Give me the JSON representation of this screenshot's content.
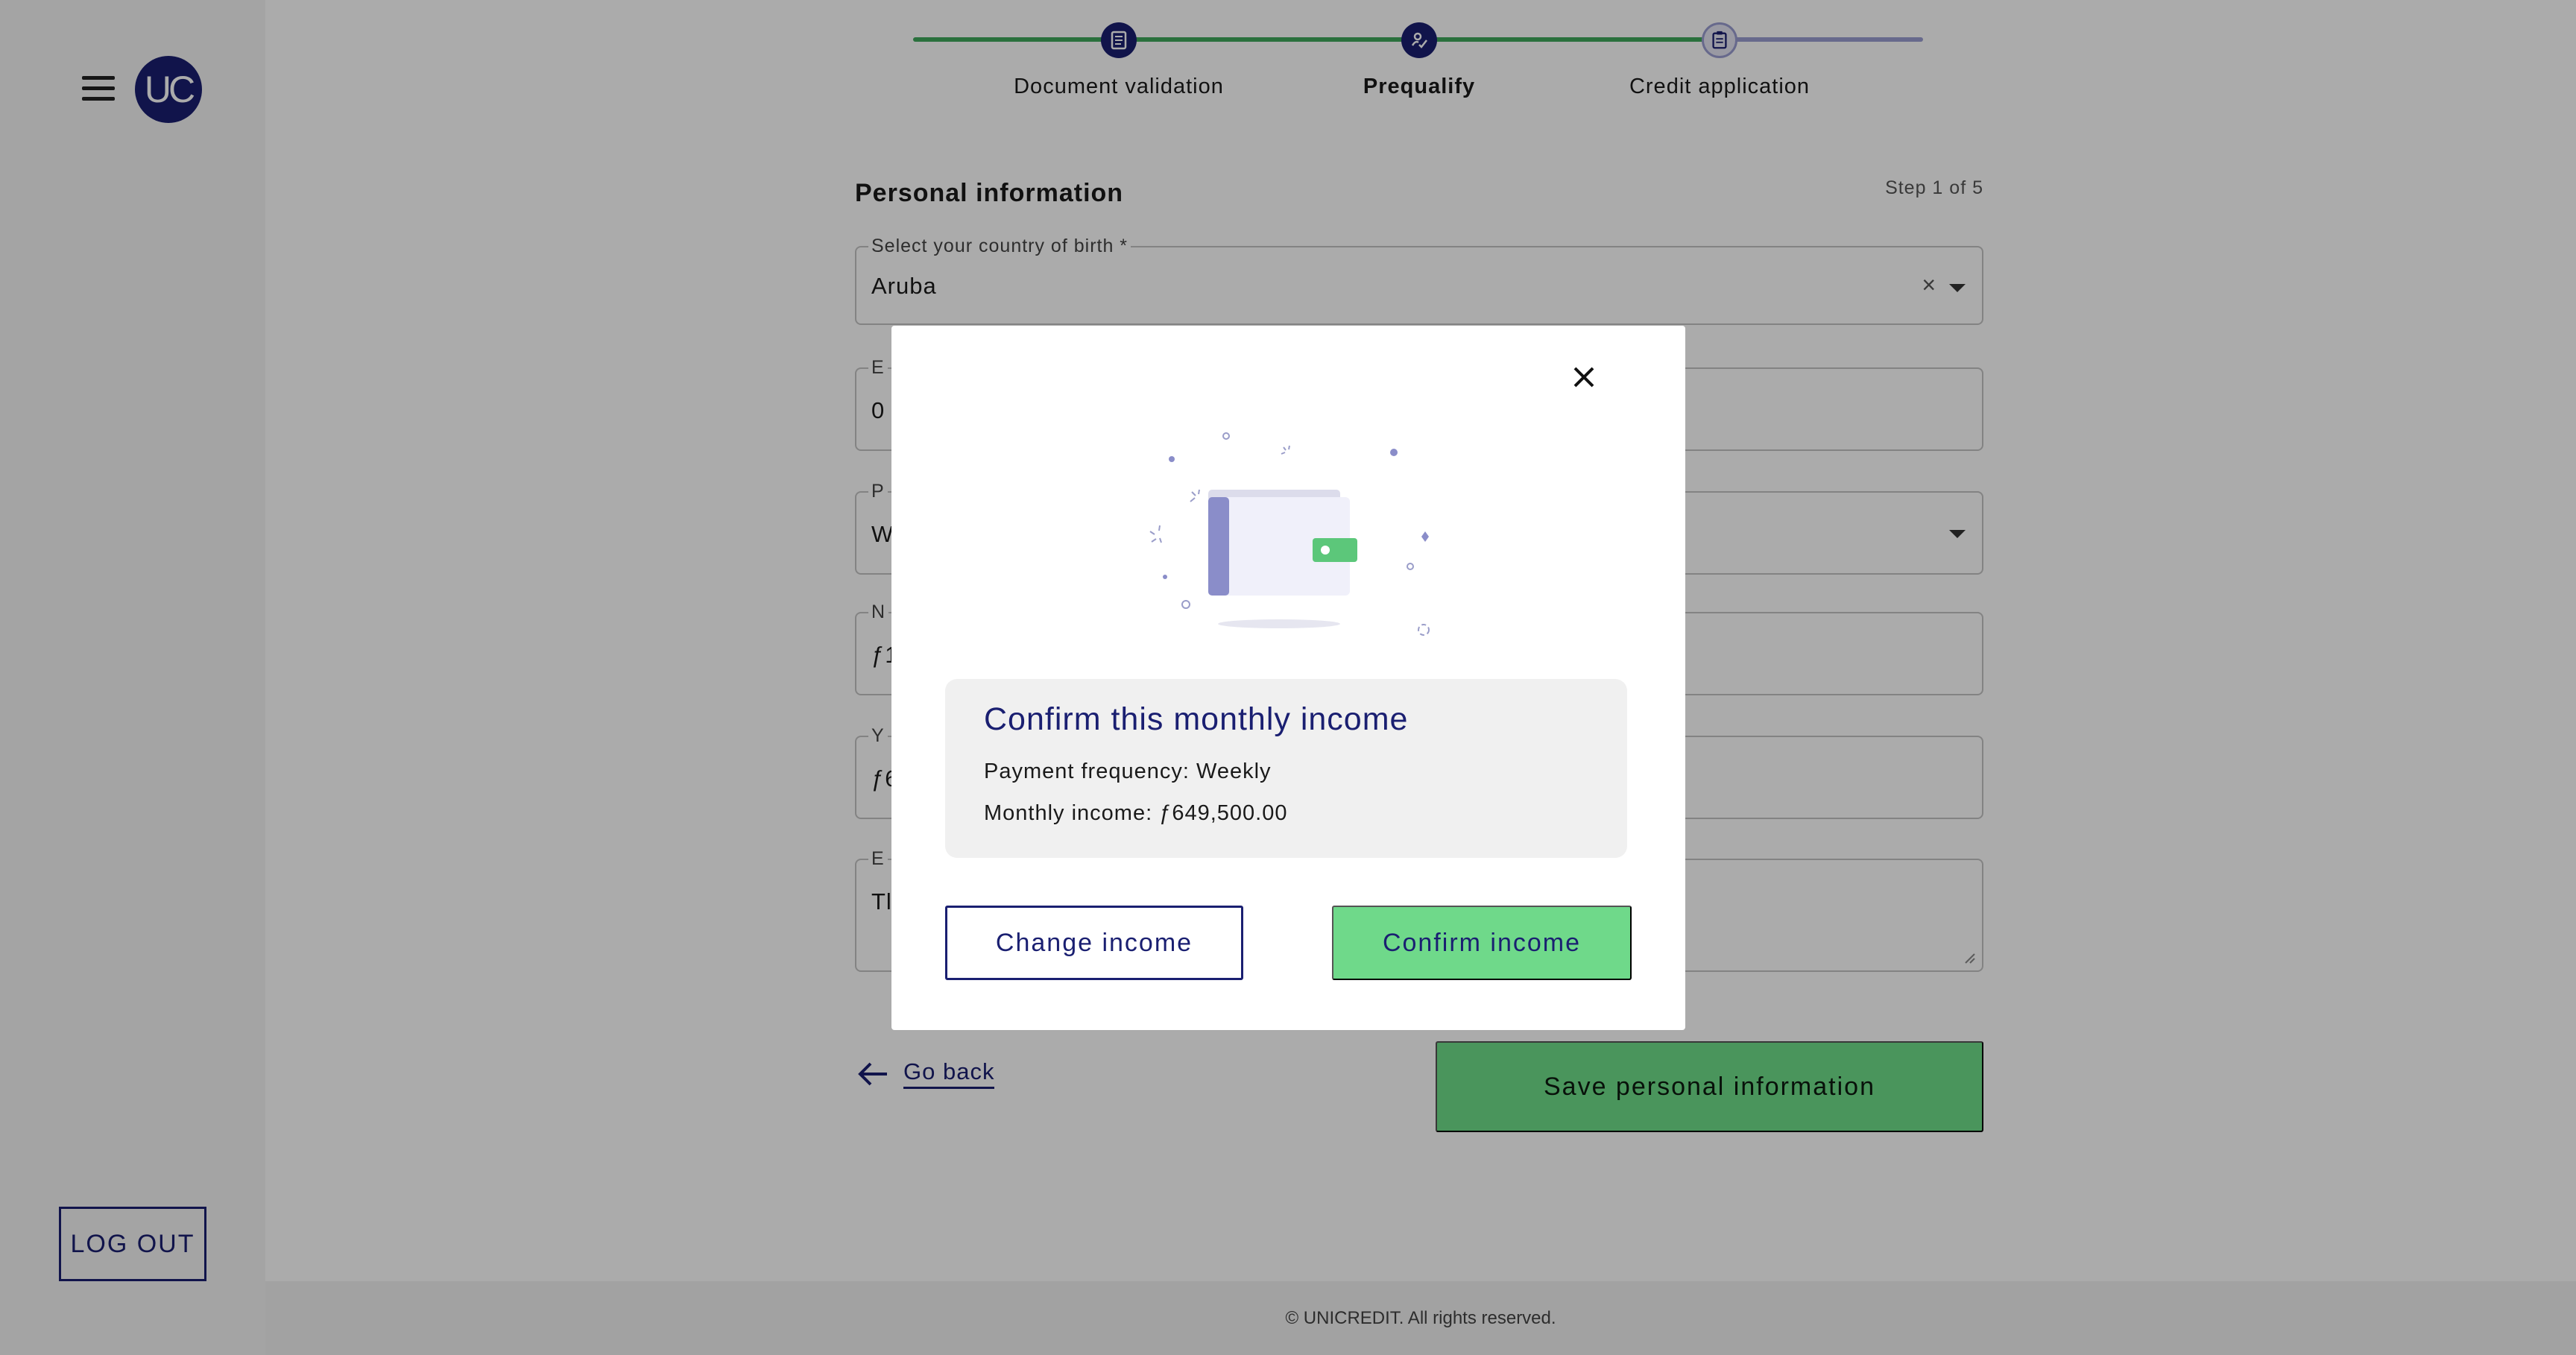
{
  "sidebar": {
    "menu_icon": "hamburger-menu-icon",
    "avatar_initials": "UC",
    "logout_label": "LOG OUT"
  },
  "stepper": {
    "steps": [
      {
        "label": "Document validation",
        "icon": "document-icon",
        "state": "complete"
      },
      {
        "label": "Prequalify",
        "icon": "signature-check-icon",
        "state": "current"
      },
      {
        "label": "Credit application",
        "icon": "clipboard-icon",
        "state": "upcoming"
      }
    ]
  },
  "form": {
    "title": "Personal information",
    "step_count": "Step 1 of 5",
    "country_label": "Select your country of birth *",
    "country_value": "Aruba",
    "field2_label": "E",
    "field2_value": "0",
    "field3_label": "P",
    "field3_value": "W",
    "field4_label": "N",
    "field4_value": "ƒ1",
    "field5_label": "Y",
    "field5_value": "ƒ6",
    "field6_label": "E",
    "field6_value": "Tl",
    "go_back_label": "Go back",
    "save_label": "Save personal information"
  },
  "modal": {
    "illustration_icon": "wallet-illustration-icon",
    "title": "Confirm this monthly income",
    "payment_frequency": "Payment frequency: Weekly",
    "monthly_income": "Monthly income: ƒ649,500.00",
    "change_label": "Change income",
    "confirm_label": "Confirm income"
  },
  "footer": {
    "copyright": "© UNICREDIT. All rights reserved."
  },
  "colors": {
    "brand_navy": "#1a1f71",
    "accent_green": "#6fde89",
    "progress_green": "#3fa85c",
    "progress_pending": "#9a9dd1"
  }
}
